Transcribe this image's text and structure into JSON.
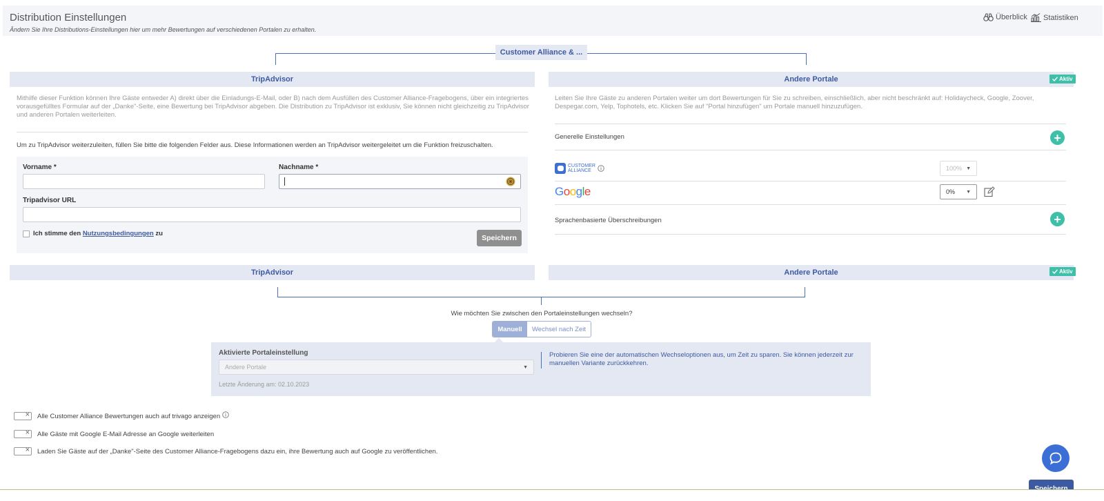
{
  "header": {
    "title": "Distribution Einstellungen",
    "subtitle": "Ändern Sie Ihre Distributions-Einstellungen hier um mehr Bewertungen auf verschiedenen Portalen zu erhalten.",
    "overview_label": "Überblick",
    "stats_label": "Statistiken"
  },
  "tree_top": {
    "label": "Customer Alliance & ..."
  },
  "tripadvisor": {
    "heading": "TripAdvisor",
    "description": "Mithilfe dieser Funktion können Ihre Gäste entweder A) direkt über die Einladungs-E-Mail, oder B) nach dem Ausfüllen des Customer Alliance-Fragebogens, über ein integriertes vorausgefülltes Formular auf der „Danke\"-Seite, eine Bewertung bei TripAdvisor abgeben. Die Distribution zu TripAdvisor ist exklusiv, Sie können nicht gleichzeitig zu TripAdvisor und anderen Portalen weiterleiten.",
    "instruction": "Um zu TripAdvisor weiterzuleiten, füllen Sie bitte die folgenden Felder aus. Diese Informationen werden an TripAdvisor weitergeleitet um die Funktion freizuschalten.",
    "first_name_label": "Vorname *",
    "first_name_value": "",
    "last_name_label": "Nachname *",
    "last_name_value": "",
    "url_label": "Tripadvisor URL",
    "url_value": "",
    "terms_prefix": "Ich stimme den",
    "terms_link": "Nutzungsbedingungen",
    "terms_suffix": "zu",
    "save_label": "Speichern"
  },
  "other_portals": {
    "heading": "Andere Portale",
    "active_badge": "Aktiv",
    "description": "Leiten Sie Ihre Gäste zu anderen Portalen weiter um dort Bewertungen für Sie zu schreiben, einschließlich, aber nicht beschränkt auf: Holidaycheck, Google, Zoover, Despegar.com, Yelp, Tophotels, etc. Klicken Sie auf \"Portal hinzufügen\" um Portale manuell hinzuzufügen.",
    "general_settings": "Generelle Einstellungen",
    "ca_logo_line1": "CUSTOMER",
    "ca_logo_line2": "ALLIANCE",
    "ca_percent": "100%",
    "google_logo": [
      "G",
      "o",
      "o",
      "g",
      "l",
      "e"
    ],
    "google_percent": "0%",
    "language_overrides": "Sprachenbasierte Überschreibungen"
  },
  "second_row": {
    "tripadvisor_heading": "TripAdvisor",
    "other_heading": "Andere Portale",
    "active_badge": "Aktiv"
  },
  "switching": {
    "question": "Wie möchten Sie zwischen den Portaleinstellungen wechseln?",
    "manual_label": "Manuell",
    "time_label": "Wechsel nach Zeit",
    "active_setting_label": "Aktivierte Portaleinstellung",
    "active_setting_value": "Andere Portale",
    "last_change": "Letzte Änderung am: 02.10.2023",
    "hint": "Probieren Sie eine der automatischen Wechseloptionen aus, um Zeit zu sparen. Sie können jederzeit zur manuellen Variante zurückkehren."
  },
  "toggles": [
    {
      "label": "Alle Customer Alliance Bewertungen auch auf trivago anzeigen"
    },
    {
      "label": "Alle Gäste mit Google E-Mail Adresse an Google weiterleiten"
    },
    {
      "label": "Laden Sie Gäste auf der „Danke\"-Seite des Customer Alliance-Fragebogens dazu ein, ihre Bewertung auch auf Google zu veröffentlichen."
    }
  ],
  "footer": {
    "save_label": "Speichern"
  },
  "colors": {
    "accent_blue": "#3d5aa0",
    "teal": "#3dbfa8",
    "panel": "#e4e8f3",
    "google_blue": "#4285F4",
    "google_red": "#EA4335",
    "google_yellow": "#FBBC05",
    "google_green": "#34A853"
  }
}
